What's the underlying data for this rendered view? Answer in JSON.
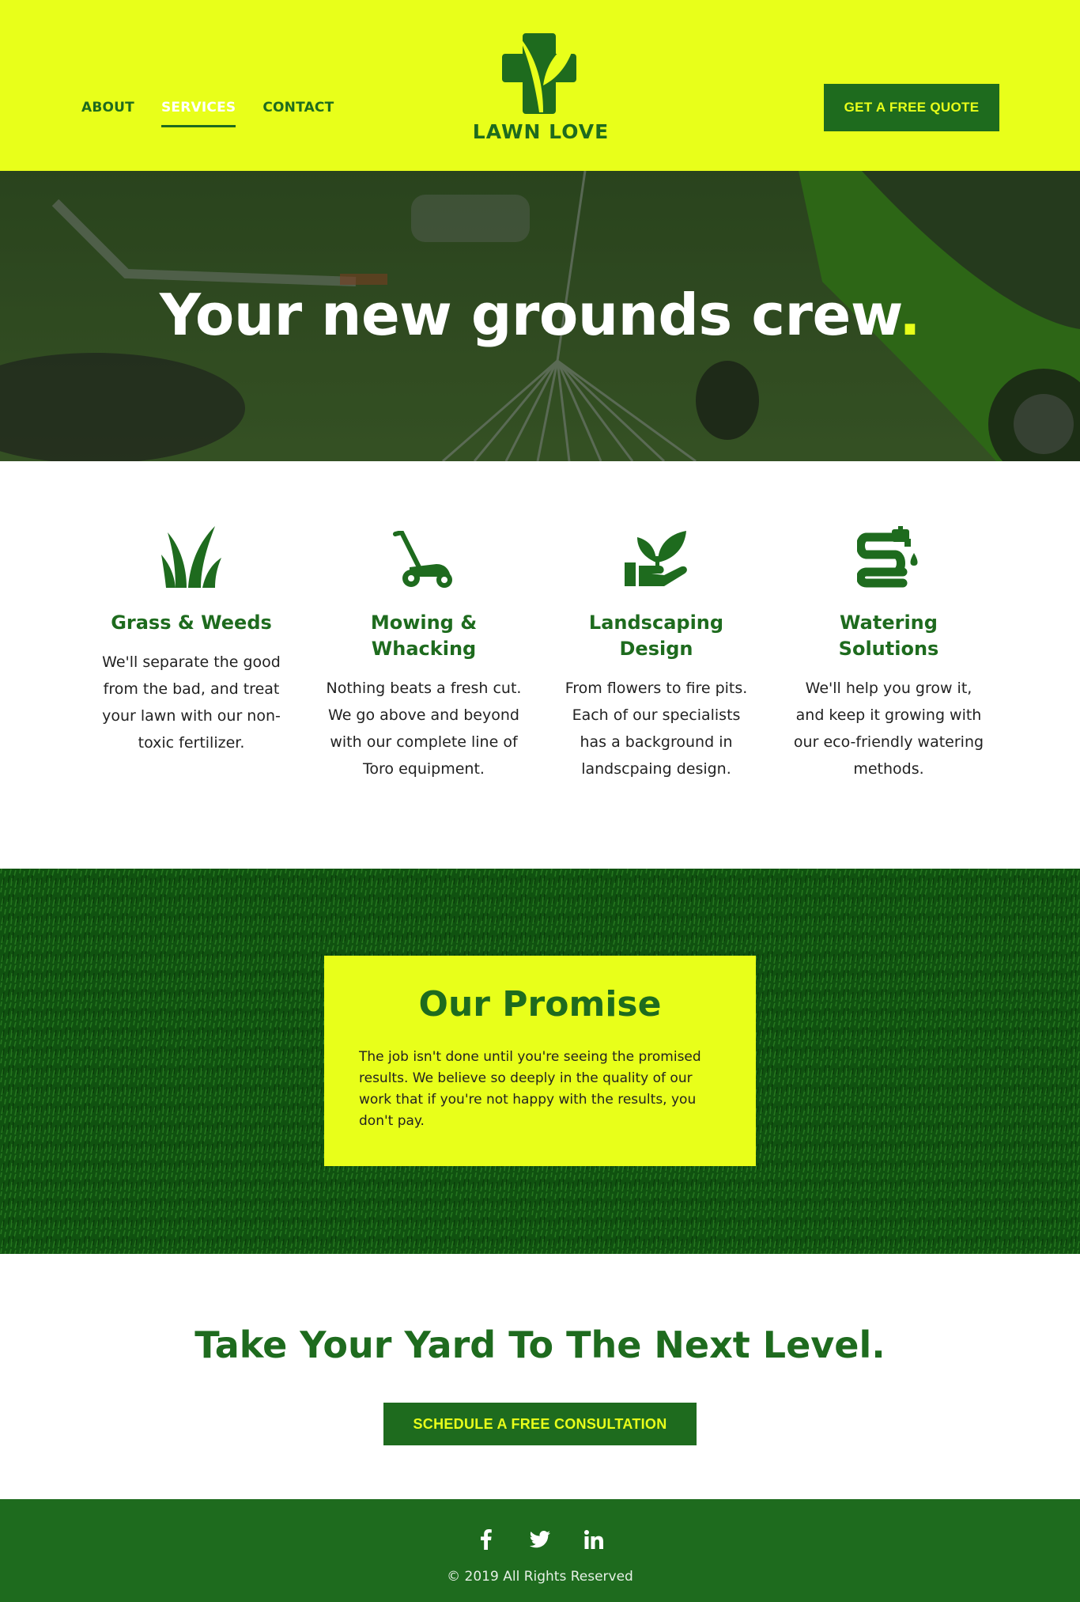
{
  "header": {
    "nav": [
      "ABOUT",
      "SERVICES",
      "CONTACT"
    ],
    "active_nav": "SERVICES",
    "logo_text": "LAWN LOVE",
    "quote_button": "GET A FREE QUOTE"
  },
  "hero": {
    "title": "Your new grounds crew",
    "title_dot": "."
  },
  "services": [
    {
      "icon": "grass-icon",
      "title": "Grass & Weeds",
      "text": "We'll separate the good from the bad, and treat your lawn with our non-toxic fertilizer."
    },
    {
      "icon": "lawn-mower-icon",
      "title": "Mowing & Whacking",
      "text": "Nothing beats a fresh cut. We go above and beyond with our complete line of Toro equipment."
    },
    {
      "icon": "plant-in-hand-icon",
      "title": "Landscaping Design",
      "text": "From flowers to fire pits. Each of our specialists has a background in landscpaing design."
    },
    {
      "icon": "hose-icon",
      "title": "Watering Solutions",
      "text": "We'll help you grow it, and keep it growing with our eco-friendly watering methods."
    }
  ],
  "promise": {
    "title": "Our Promise",
    "text": "The job isn't done until you're seeing the promised results. We believe so deeply in the quality of our work that if you're not happy with the results, you don't pay."
  },
  "cta": {
    "title": "Take Your Yard To The Next Level.",
    "button": "SCHEDULE A FREE CONSULTATION"
  },
  "footer": {
    "social": [
      "facebook-icon",
      "twitter-icon",
      "linkedin-icon"
    ],
    "copyright": "© 2019 All Rights Reserved"
  },
  "colors": {
    "accent_yellow": "#e8ff1a",
    "brand_green": "#1e6b1e"
  }
}
